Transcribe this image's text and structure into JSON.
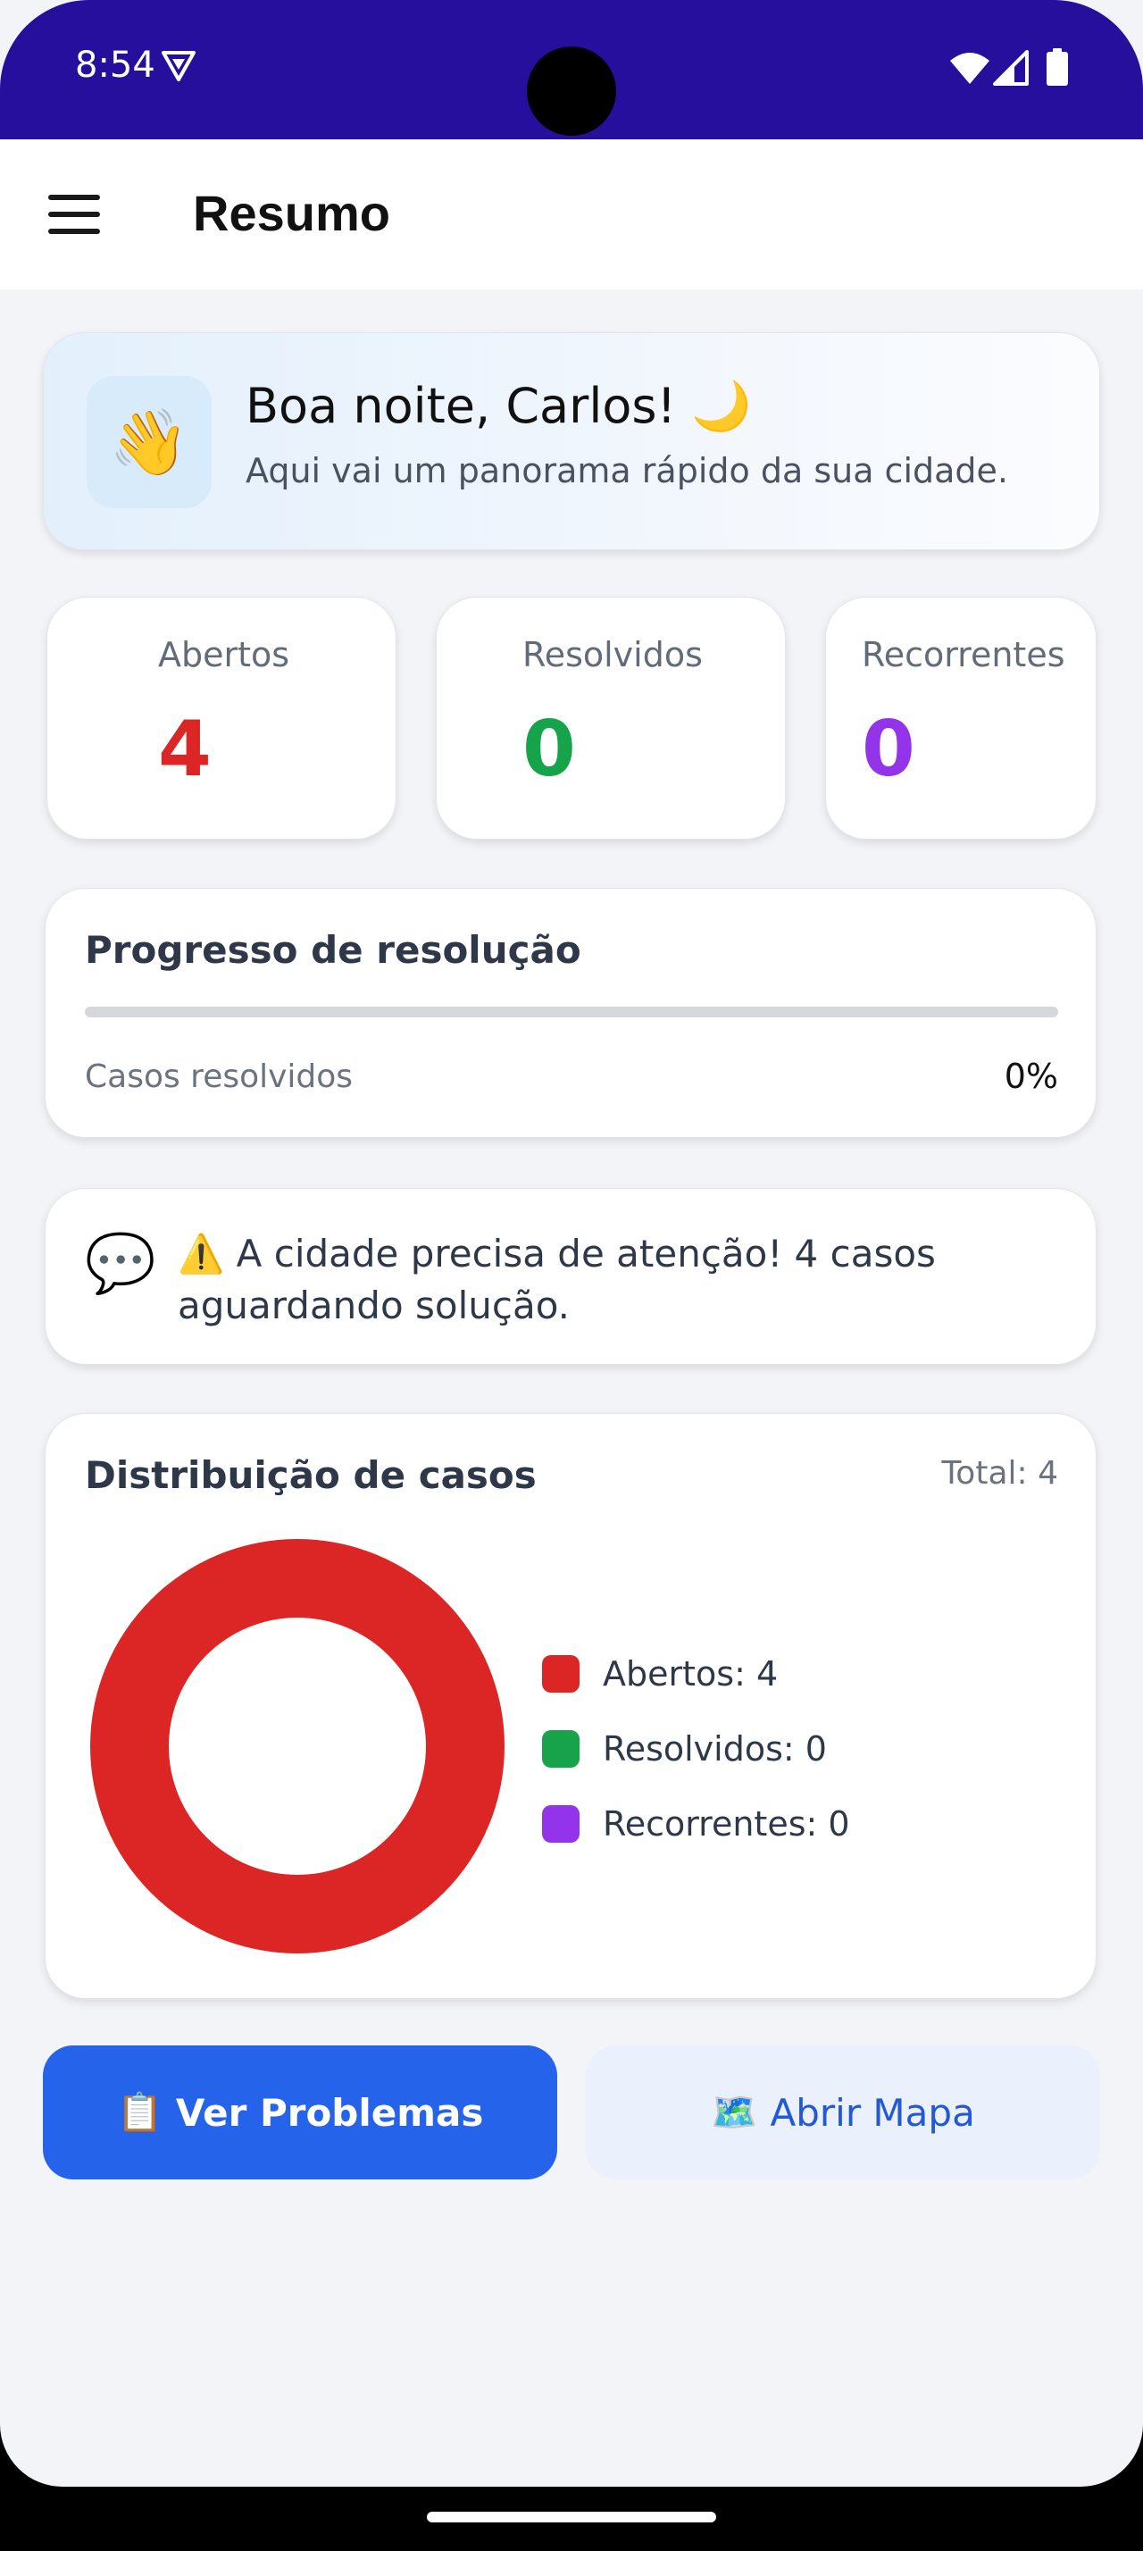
{
  "status_bar": {
    "time": "8:54",
    "icons": [
      "vpn-icon",
      "wifi-icon",
      "signal-icon",
      "battery-icon"
    ]
  },
  "app_bar": {
    "menu_icon": "hamburger-menu-icon",
    "title": "Resumo"
  },
  "greeting": {
    "icon": "👋",
    "title": "Boa noite, Carlos! 🌙",
    "subtitle": "Aqui vai um panorama rápido da sua cidade."
  },
  "stats": {
    "open": {
      "label": "Abertos",
      "value": "4",
      "color": "#dc2626"
    },
    "resolved": {
      "label": "Resolvidos",
      "value": "0",
      "color": "#16a34a"
    },
    "recurring": {
      "label": "Recorrentes",
      "value": "0",
      "color": "#9333ea"
    }
  },
  "progress": {
    "title": "Progresso de resolução",
    "label": "Casos resolvidos",
    "percent_text": "0%",
    "fraction": 0
  },
  "alert": {
    "icon": "💬",
    "text": "⚠️ A cidade precisa de atenção! 4 casos aguardando solução."
  },
  "distribution": {
    "title": "Distribuição de casos",
    "total_text": "Total: 4",
    "legend": [
      {
        "text": "Abertos: 4",
        "color": "#dc2626"
      },
      {
        "text": "Resolvidos: 0",
        "color": "#16a34a"
      },
      {
        "text": "Recorrentes: 0",
        "color": "#9333ea"
      }
    ]
  },
  "chart_data": {
    "type": "pie",
    "categories": [
      "Abertos",
      "Resolvidos",
      "Recorrentes"
    ],
    "values": [
      4,
      0,
      0
    ],
    "colors": [
      "#dc2626",
      "#16a34a",
      "#9333ea"
    ],
    "title": "Distribuição de casos",
    "donut": true,
    "legend_position": "right"
  },
  "actions": {
    "problems": {
      "emoji": "📋",
      "label": "Ver Problemas"
    },
    "map": {
      "emoji": "🗺️",
      "label": "Abrir Mapa"
    }
  },
  "colors": {
    "status_bar": "#260f9c",
    "primary": "#2563eb",
    "background": "#f3f4f8"
  }
}
